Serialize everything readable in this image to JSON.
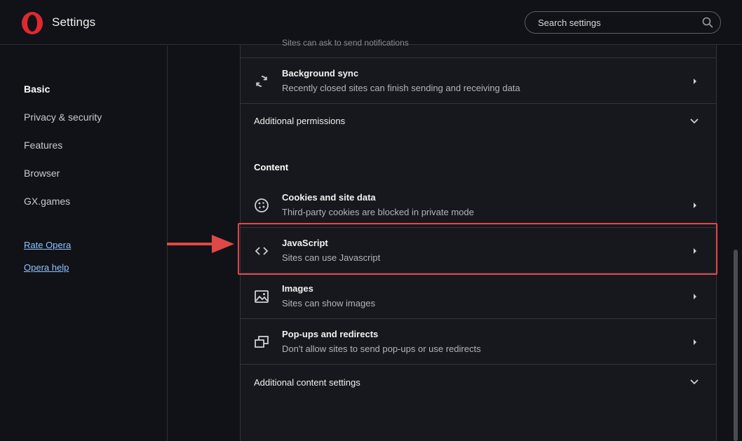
{
  "header": {
    "app_title": "Settings",
    "search_placeholder": "Search settings",
    "logo_icon": "opera-logo-icon",
    "brand_color": "#e0282f"
  },
  "sidebar": {
    "items": [
      {
        "label": "Basic",
        "active": true
      },
      {
        "label": "Privacy & security"
      },
      {
        "label": "Features"
      },
      {
        "label": "Browser"
      },
      {
        "label": "GX.games"
      }
    ],
    "links": [
      {
        "label": "Rate Opera"
      },
      {
        "label": "Opera help"
      }
    ]
  },
  "content": {
    "cutoff_text": "Sites can ask to send notifications",
    "rows_top": [
      {
        "title": "Background sync",
        "subtitle": "Recently closed sites can finish sending and receiving data",
        "icon": "sync-icon"
      }
    ],
    "additional_permissions": "Additional permissions",
    "content_heading": "Content",
    "rows": [
      {
        "title": "Cookies and site data",
        "subtitle": "Third-party cookies are blocked in private mode",
        "icon": "cookie-icon"
      },
      {
        "title": "JavaScript",
        "subtitle": "Sites can use Javascript",
        "icon": "code-icon"
      },
      {
        "title": "Images",
        "subtitle": "Sites can show images",
        "icon": "image-icon"
      },
      {
        "title": "Pop-ups and redirects",
        "subtitle": "Don't allow sites to send pop-ups or use redirects",
        "icon": "popup-icon"
      }
    ],
    "additional_content_settings": "Additional content settings"
  },
  "annotation": {
    "highlight_color": "#e04848"
  }
}
